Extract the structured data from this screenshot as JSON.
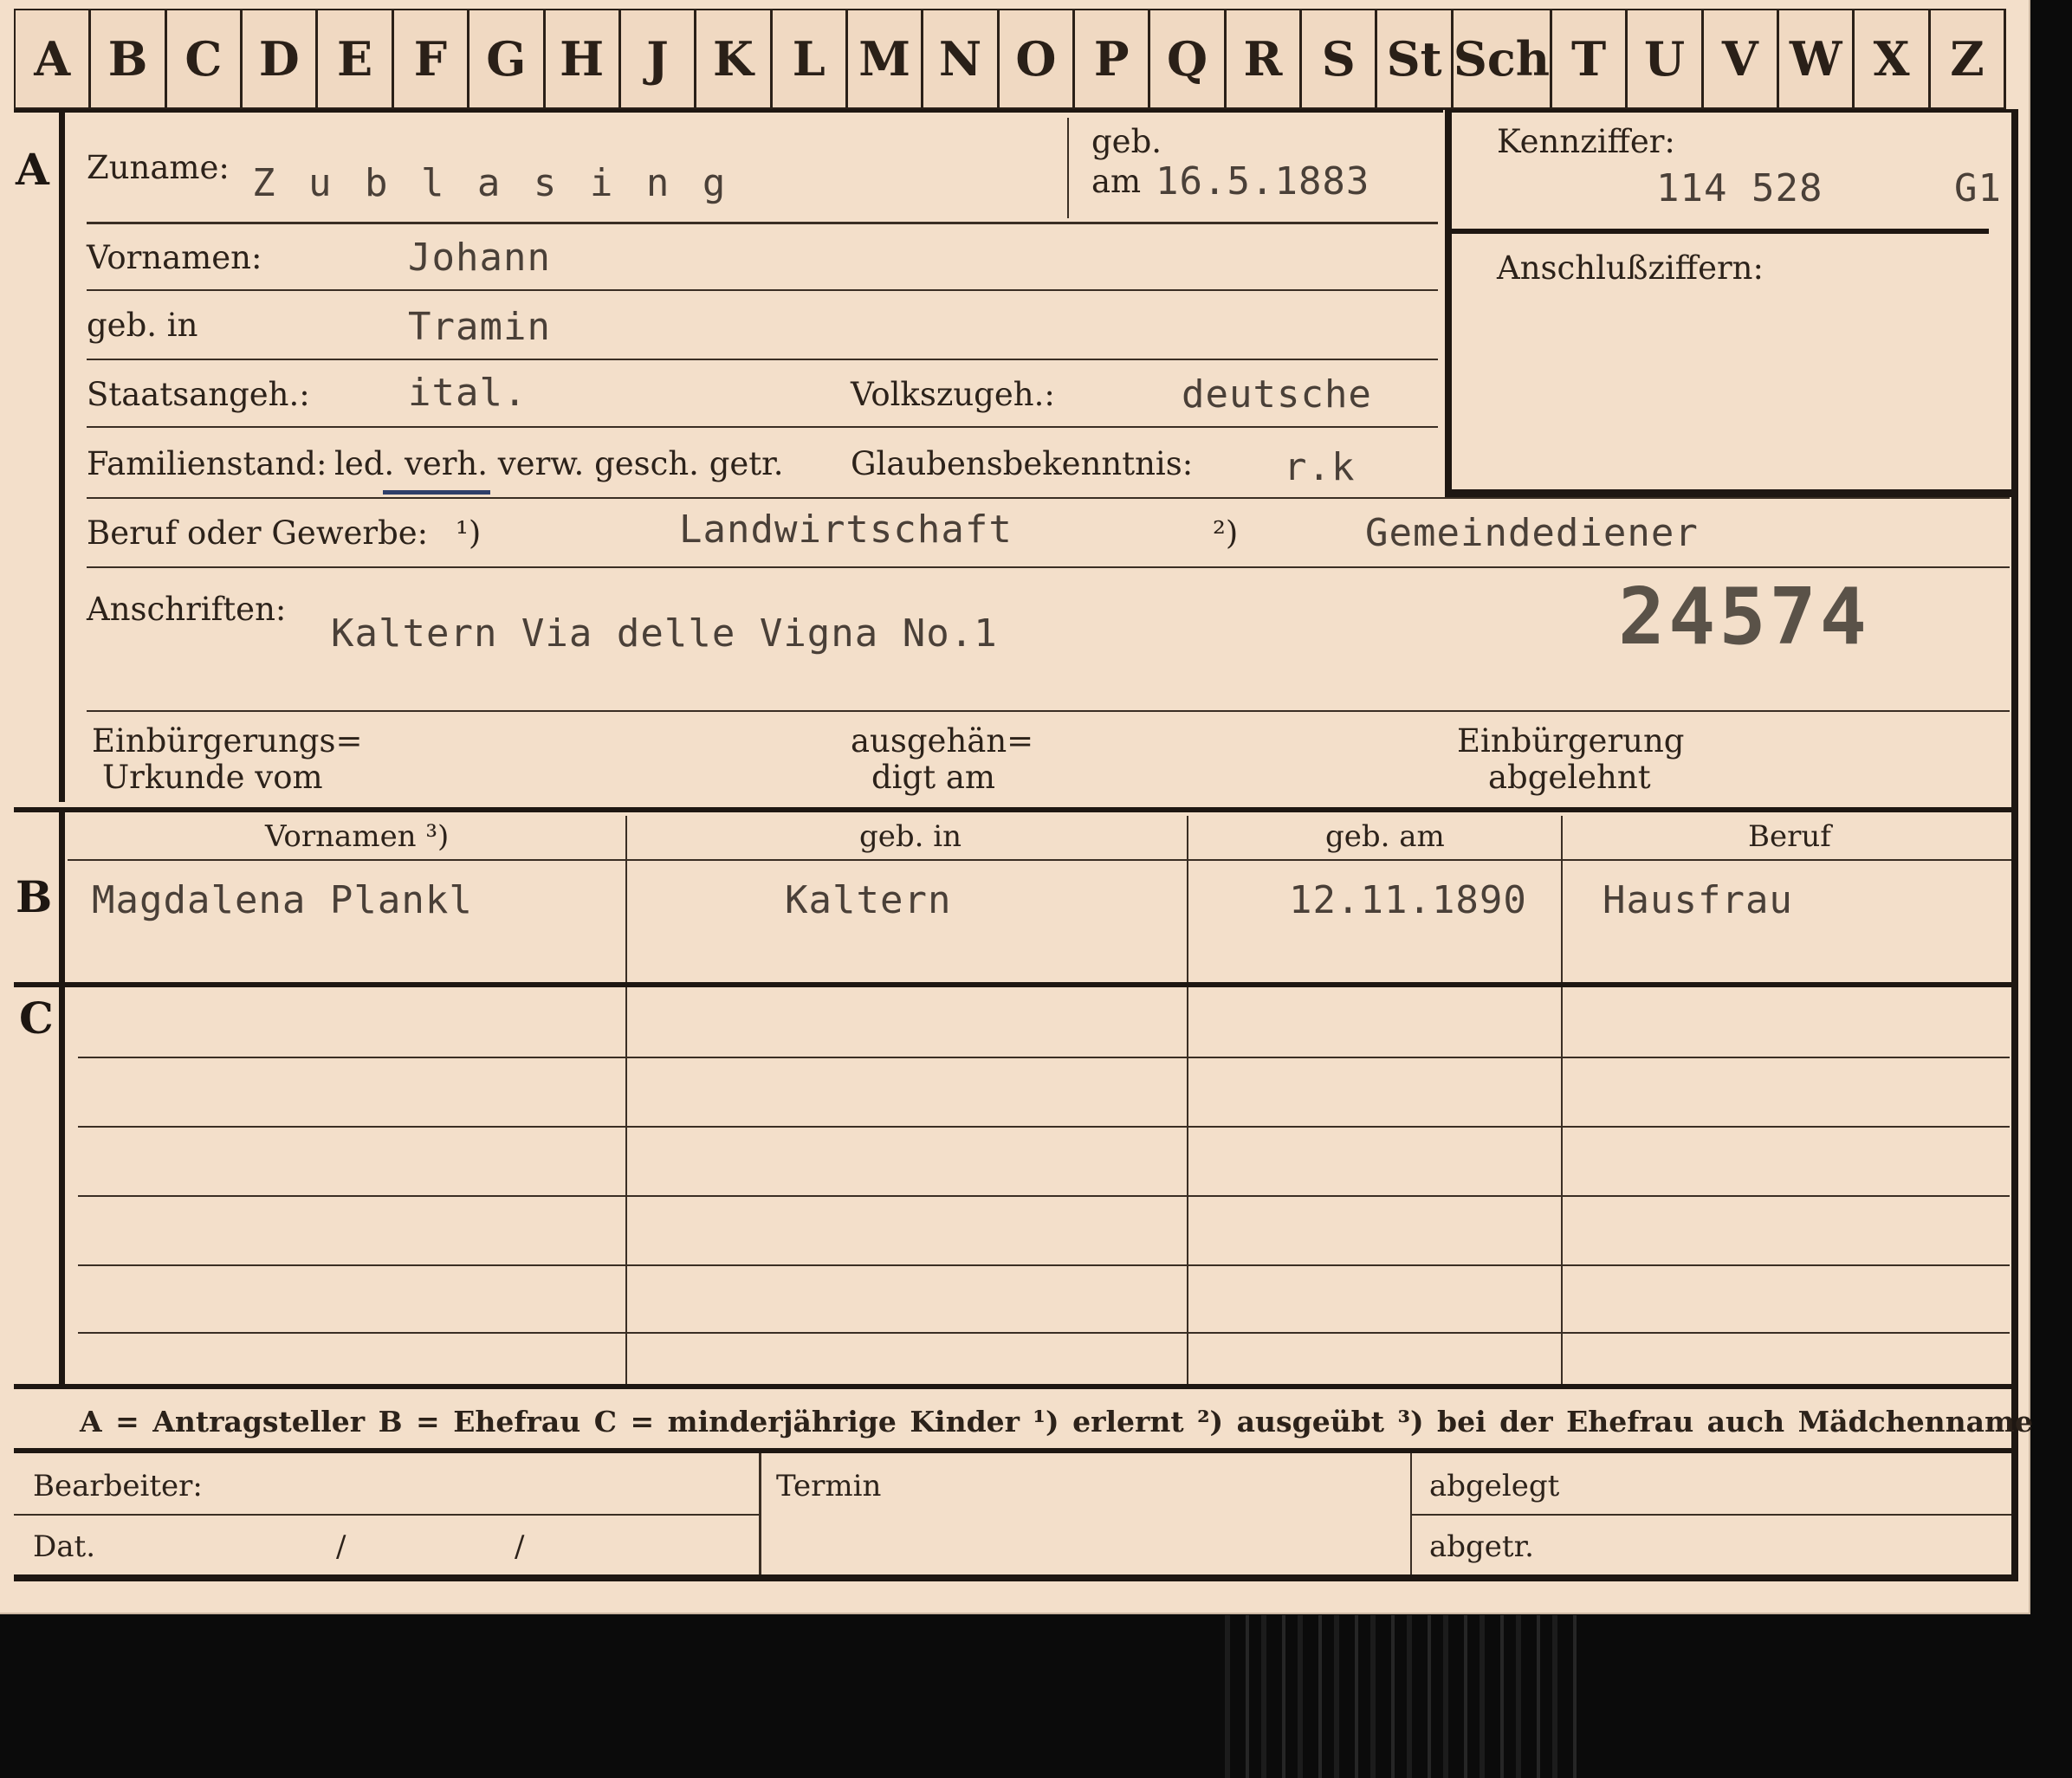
{
  "tabs": [
    "A",
    "B",
    "C",
    "D",
    "E",
    "F",
    "G",
    "H",
    "J",
    "K",
    "L",
    "M",
    "N",
    "O",
    "P",
    "Q",
    "R",
    "S",
    "St",
    "Sch",
    "T",
    "U",
    "V",
    "W",
    "X",
    "Z"
  ],
  "sections": {
    "a": "A",
    "b": "B",
    "c": "C"
  },
  "labels": {
    "zuname": "Zuname:",
    "geb": "geb.",
    "am": "am",
    "vornamen": "Vornamen:",
    "geb_in": "geb. in",
    "staatsangeh": "Staatsangeh.:",
    "volkszugeh": "Volkszugeh.:",
    "familienstand": "Familienstand:",
    "fam_opts": "led. verh. verw. gesch. getr.",
    "glaubens": "Glaubensbekenntnis:",
    "beruf": "Beruf oder Gewerbe:",
    "beruf_n1": "¹)",
    "beruf_n2": "²)",
    "anschriften": "Anschriften:",
    "einb1": "Einbürgerungs=",
    "einb2": "Urkunde vom",
    "ausg1": "ausgehän=",
    "ausg2": "digt am",
    "abgel1": "Einbürgerung",
    "abgel2": "abgelehnt",
    "kennziffer": "Kennziffer:",
    "anschluss": "Anschlußziffern:",
    "col_vornamen": "Vornamen ³)",
    "col_gebin": "geb. in",
    "col_gebam": "geb. am",
    "col_beruf": "Beruf",
    "legend": "A = Antragsteller   B = Ehefrau   C = minderjährige Kinder   ¹) erlernt   ²) ausgeübt   ³) bei der Ehefrau auch Mädchenname",
    "bearbeiter": "Bearbeiter:",
    "dat": "Dat.",
    "slash": "/",
    "termin": "Termin",
    "abgelegt": "abgelegt",
    "abgetr": "abgetr."
  },
  "values": {
    "zuname": "Z u b l a s i n g",
    "geb_am": "16.5.1883",
    "vornamen": "Johann",
    "geb_in": "Tramin",
    "staatsangeh": "ital.",
    "volkszugeh": "deutsche",
    "glaubens": "r.k",
    "beruf1": "Landwirtschaft",
    "beruf2": "Gemeindediener",
    "anschrift": "Kaltern Via delle Vigna No.1",
    "stamp": "24574",
    "kennziffer": "114 528",
    "kennziffer_suffix": "G1"
  },
  "ehefrau": {
    "vornamen": "Magdalena Plankl",
    "geb_in": "Kaltern",
    "geb_am": "12.11.1890",
    "beruf": "Hausfrau"
  }
}
